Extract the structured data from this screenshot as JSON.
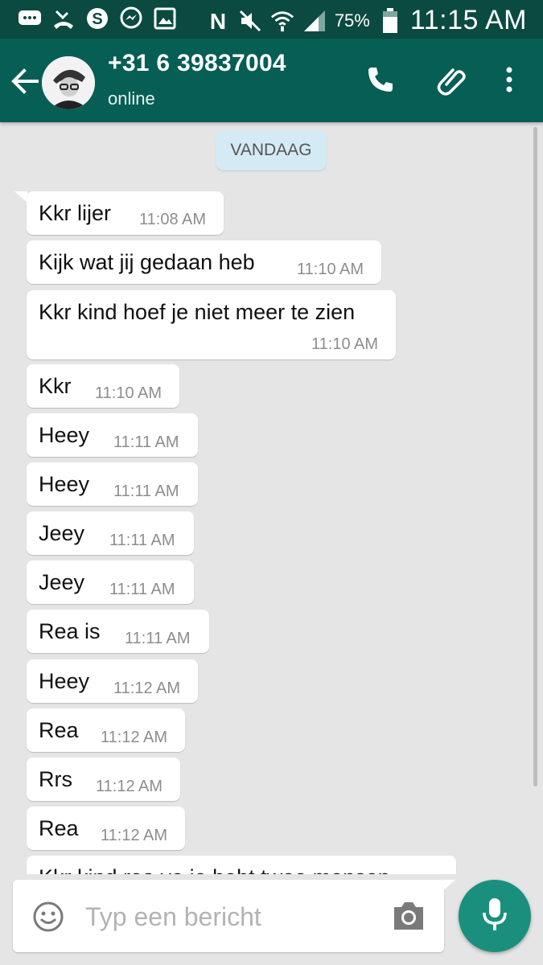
{
  "status_bar": {
    "battery_percent": "75%",
    "time": "11:15 AM",
    "icons": [
      "message-icon",
      "missed-call-icon",
      "skype-icon",
      "messenger-icon",
      "gallery-icon",
      "nfc-icon",
      "mute-icon",
      "wifi-icon",
      "signal-icon",
      "battery-icon"
    ]
  },
  "header": {
    "contact_name": "+31 6 39837004",
    "contact_status": "online",
    "icons": [
      "back-arrow-icon",
      "call-icon",
      "attach-icon",
      "more-icon"
    ]
  },
  "chat": {
    "date_label": "VANDAAG",
    "messages": [
      {
        "text": "Kkr lijer",
        "time": "11:08 AM"
      },
      {
        "text": "Kijk wat jij gedaan heb",
        "time": "11:10 AM"
      },
      {
        "text": "Kkr kind hoef je niet meer te zien",
        "time": "11:10 AM"
      },
      {
        "text": "Kkr",
        "time": "11:10 AM"
      },
      {
        "text": "Heey",
        "time": "11:11 AM"
      },
      {
        "text": "Heey",
        "time": "11:11 AM"
      },
      {
        "text": "Jeey",
        "time": "11:11 AM"
      },
      {
        "text": "Jeey",
        "time": "11:11 AM"
      },
      {
        "text": "Rea is",
        "time": "11:11 AM"
      },
      {
        "text": "Heey",
        "time": "11:12 AM"
      },
      {
        "text": "Rea",
        "time": "11:12 AM"
      },
      {
        "text": "Rrs",
        "time": "11:12 AM"
      },
      {
        "text": "Rea",
        "time": "11:12 AM"
      },
      {
        "text": "Kkr kind rea ye je hebt twee mensen",
        "time": ""
      }
    ]
  },
  "composer": {
    "placeholder": "Typ een bericht"
  },
  "colors": {
    "status_bar": "#0b4a40",
    "app_bar": "#075e54",
    "chat_bg": "#e5e5e5",
    "mic_button": "#1a8f7e",
    "date_chip": "#d4eaf4"
  }
}
